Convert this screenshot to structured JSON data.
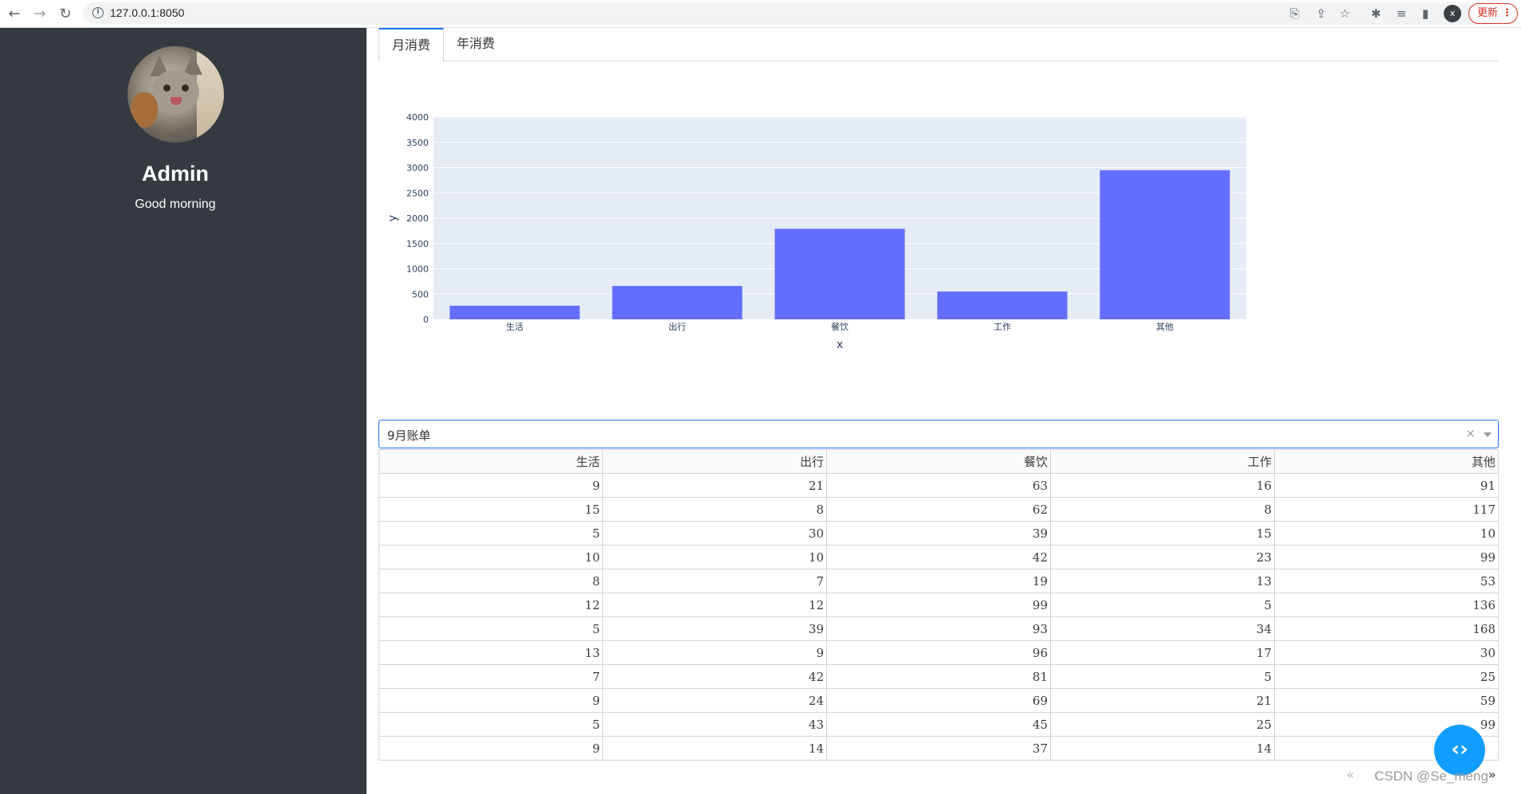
{
  "browser": {
    "url": "127.0.0.1:8050",
    "profile_initial": "x",
    "update_label": "更新"
  },
  "sidebar": {
    "name": "Admin",
    "greeting": "Good morning"
  },
  "tabs": [
    {
      "label": "月消费",
      "active": true
    },
    {
      "label": "年消费",
      "active": false
    }
  ],
  "chart_data": {
    "type": "bar",
    "categories": [
      "生活",
      "出行",
      "餐饮",
      "工作",
      "其他"
    ],
    "values": [
      270,
      660,
      1790,
      550,
      2950
    ],
    "xlabel": "x",
    "ylabel": "y",
    "ylim": [
      0,
      4000
    ],
    "yticks": [
      0,
      500,
      1000,
      1500,
      2000,
      2500,
      3000,
      3500,
      4000
    ],
    "bar_color": "#636efa",
    "plot_bg": "#e5ecf6",
    "grid": true
  },
  "dropdown": {
    "value": "9月账单",
    "clear": "×"
  },
  "table": {
    "columns": [
      "生活",
      "出行",
      "餐饮",
      "工作",
      "其他"
    ],
    "rows": [
      [
        "9",
        "21",
        "63",
        "16",
        "91"
      ],
      [
        "15",
        "8",
        "62",
        "8",
        "117"
      ],
      [
        "5",
        "30",
        "39",
        "15",
        "10"
      ],
      [
        "10",
        "10",
        "42",
        "23",
        "99"
      ],
      [
        "8",
        "7",
        "19",
        "13",
        "53"
      ],
      [
        "12",
        "12",
        "99",
        "5",
        "136"
      ],
      [
        "5",
        "39",
        "93",
        "34",
        "168"
      ],
      [
        "13",
        "9",
        "96",
        "17",
        "30"
      ],
      [
        "7",
        "42",
        "81",
        "5",
        "25"
      ],
      [
        "9",
        "24",
        "69",
        "21",
        "59"
      ],
      [
        "5",
        "43",
        "45",
        "25",
        "99"
      ],
      [
        "9",
        "14",
        "37",
        "14",
        ""
      ]
    ]
  },
  "pager": {
    "first": "«",
    "prev": "‹",
    "next": "»"
  },
  "watermark": "CSDN @Se_meng"
}
